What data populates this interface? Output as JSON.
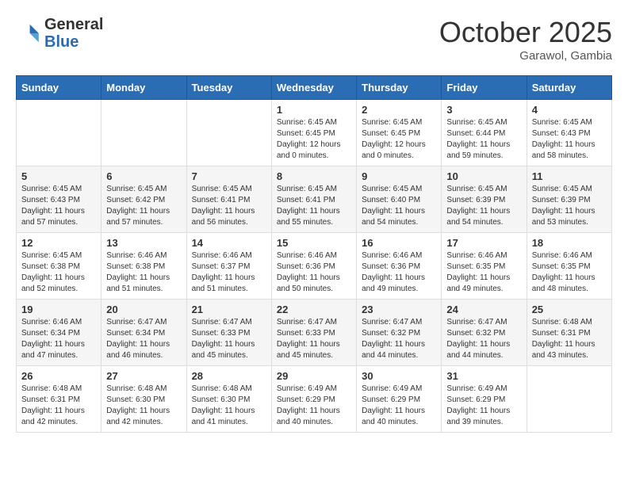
{
  "header": {
    "logo_general": "General",
    "logo_blue": "Blue",
    "month_title": "October 2025",
    "subtitle": "Garawol, Gambia"
  },
  "days_of_week": [
    "Sunday",
    "Monday",
    "Tuesday",
    "Wednesday",
    "Thursday",
    "Friday",
    "Saturday"
  ],
  "weeks": [
    [
      {
        "day": "",
        "info": ""
      },
      {
        "day": "",
        "info": ""
      },
      {
        "day": "",
        "info": ""
      },
      {
        "day": "1",
        "info": "Sunrise: 6:45 AM\nSunset: 6:45 PM\nDaylight: 12 hours\nand 0 minutes."
      },
      {
        "day": "2",
        "info": "Sunrise: 6:45 AM\nSunset: 6:45 PM\nDaylight: 12 hours\nand 0 minutes."
      },
      {
        "day": "3",
        "info": "Sunrise: 6:45 AM\nSunset: 6:44 PM\nDaylight: 11 hours\nand 59 minutes."
      },
      {
        "day": "4",
        "info": "Sunrise: 6:45 AM\nSunset: 6:43 PM\nDaylight: 11 hours\nand 58 minutes."
      }
    ],
    [
      {
        "day": "5",
        "info": "Sunrise: 6:45 AM\nSunset: 6:43 PM\nDaylight: 11 hours\nand 57 minutes."
      },
      {
        "day": "6",
        "info": "Sunrise: 6:45 AM\nSunset: 6:42 PM\nDaylight: 11 hours\nand 57 minutes."
      },
      {
        "day": "7",
        "info": "Sunrise: 6:45 AM\nSunset: 6:41 PM\nDaylight: 11 hours\nand 56 minutes."
      },
      {
        "day": "8",
        "info": "Sunrise: 6:45 AM\nSunset: 6:41 PM\nDaylight: 11 hours\nand 55 minutes."
      },
      {
        "day": "9",
        "info": "Sunrise: 6:45 AM\nSunset: 6:40 PM\nDaylight: 11 hours\nand 54 minutes."
      },
      {
        "day": "10",
        "info": "Sunrise: 6:45 AM\nSunset: 6:39 PM\nDaylight: 11 hours\nand 54 minutes."
      },
      {
        "day": "11",
        "info": "Sunrise: 6:45 AM\nSunset: 6:39 PM\nDaylight: 11 hours\nand 53 minutes."
      }
    ],
    [
      {
        "day": "12",
        "info": "Sunrise: 6:45 AM\nSunset: 6:38 PM\nDaylight: 11 hours\nand 52 minutes."
      },
      {
        "day": "13",
        "info": "Sunrise: 6:46 AM\nSunset: 6:38 PM\nDaylight: 11 hours\nand 51 minutes."
      },
      {
        "day": "14",
        "info": "Sunrise: 6:46 AM\nSunset: 6:37 PM\nDaylight: 11 hours\nand 51 minutes."
      },
      {
        "day": "15",
        "info": "Sunrise: 6:46 AM\nSunset: 6:36 PM\nDaylight: 11 hours\nand 50 minutes."
      },
      {
        "day": "16",
        "info": "Sunrise: 6:46 AM\nSunset: 6:36 PM\nDaylight: 11 hours\nand 49 minutes."
      },
      {
        "day": "17",
        "info": "Sunrise: 6:46 AM\nSunset: 6:35 PM\nDaylight: 11 hours\nand 49 minutes."
      },
      {
        "day": "18",
        "info": "Sunrise: 6:46 AM\nSunset: 6:35 PM\nDaylight: 11 hours\nand 48 minutes."
      }
    ],
    [
      {
        "day": "19",
        "info": "Sunrise: 6:46 AM\nSunset: 6:34 PM\nDaylight: 11 hours\nand 47 minutes."
      },
      {
        "day": "20",
        "info": "Sunrise: 6:47 AM\nSunset: 6:34 PM\nDaylight: 11 hours\nand 46 minutes."
      },
      {
        "day": "21",
        "info": "Sunrise: 6:47 AM\nSunset: 6:33 PM\nDaylight: 11 hours\nand 45 minutes."
      },
      {
        "day": "22",
        "info": "Sunrise: 6:47 AM\nSunset: 6:33 PM\nDaylight: 11 hours\nand 45 minutes."
      },
      {
        "day": "23",
        "info": "Sunrise: 6:47 AM\nSunset: 6:32 PM\nDaylight: 11 hours\nand 44 minutes."
      },
      {
        "day": "24",
        "info": "Sunrise: 6:47 AM\nSunset: 6:32 PM\nDaylight: 11 hours\nand 44 minutes."
      },
      {
        "day": "25",
        "info": "Sunrise: 6:48 AM\nSunset: 6:31 PM\nDaylight: 11 hours\nand 43 minutes."
      }
    ],
    [
      {
        "day": "26",
        "info": "Sunrise: 6:48 AM\nSunset: 6:31 PM\nDaylight: 11 hours\nand 42 minutes."
      },
      {
        "day": "27",
        "info": "Sunrise: 6:48 AM\nSunset: 6:30 PM\nDaylight: 11 hours\nand 42 minutes."
      },
      {
        "day": "28",
        "info": "Sunrise: 6:48 AM\nSunset: 6:30 PM\nDaylight: 11 hours\nand 41 minutes."
      },
      {
        "day": "29",
        "info": "Sunrise: 6:49 AM\nSunset: 6:29 PM\nDaylight: 11 hours\nand 40 minutes."
      },
      {
        "day": "30",
        "info": "Sunrise: 6:49 AM\nSunset: 6:29 PM\nDaylight: 11 hours\nand 40 minutes."
      },
      {
        "day": "31",
        "info": "Sunrise: 6:49 AM\nSunset: 6:29 PM\nDaylight: 11 hours\nand 39 minutes."
      },
      {
        "day": "",
        "info": ""
      }
    ]
  ]
}
